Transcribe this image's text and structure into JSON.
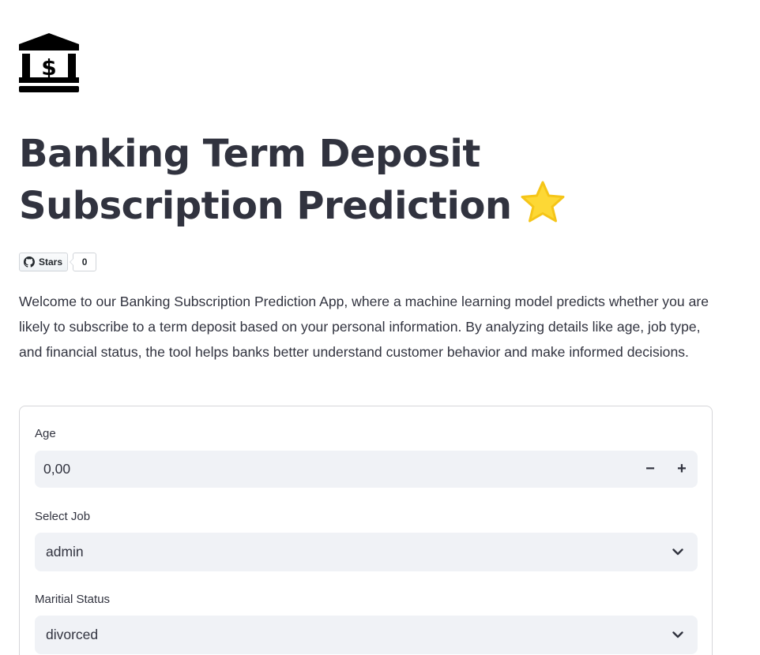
{
  "app": {
    "title": "Banking Term Deposit Subscription Prediction",
    "title_emoji": "star",
    "logo_icon": "bank-icon"
  },
  "github_badge": {
    "label": "Stars",
    "count": "0"
  },
  "intro": "Welcome to our Banking Subscription Prediction App, where a machine learning model predicts whether you are likely to subscribe to a term deposit based on your personal information. By analyzing details like age, job type, and financial status, the tool helps banks better understand customer behavior and make informed decisions.",
  "form": {
    "age": {
      "label": "Age",
      "value": "0,00",
      "minus": "−",
      "plus": "+"
    },
    "job": {
      "label": "Select Job",
      "value": "admin"
    },
    "marital": {
      "label": "Maritial Status",
      "value": "divorced"
    }
  },
  "colors": {
    "text": "#31333f",
    "input_bg": "#f0f2f6",
    "star": "#fdd835",
    "border": "#d6d6d9"
  }
}
